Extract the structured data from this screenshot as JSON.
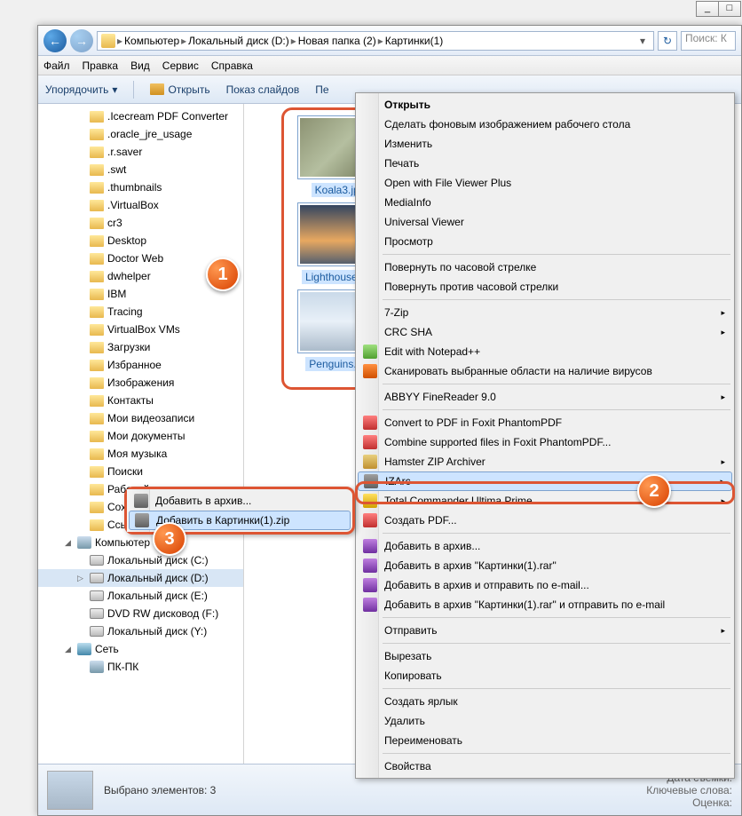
{
  "titlebar": {
    "min": "_",
    "max": "□"
  },
  "nav": {
    "back": "←",
    "fwd": "→",
    "refresh": "↻"
  },
  "breadcrumb": {
    "sep": "▸",
    "items": [
      "Компьютер",
      "Локальный диск (D:)",
      "Новая папка (2)",
      "Картинки(1)"
    ],
    "drop": "▾"
  },
  "search": {
    "placeholder": "Поиск: К"
  },
  "menu": {
    "items": [
      "Файл",
      "Правка",
      "Вид",
      "Сервис",
      "Справка"
    ]
  },
  "toolbar": {
    "organize": "Упорядочить",
    "organize_arr": "▾",
    "open": "Открыть",
    "slideshow": "Показ слайдов",
    "more": "Пе"
  },
  "tree": {
    "items": [
      {
        "l": 1,
        "t": "folder",
        "label": ".Icecream PDF Converter"
      },
      {
        "l": 1,
        "t": "folder",
        "label": ".oracle_jre_usage"
      },
      {
        "l": 1,
        "t": "folder",
        "label": ".r.saver"
      },
      {
        "l": 1,
        "t": "folder",
        "label": ".swt"
      },
      {
        "l": 1,
        "t": "folder",
        "label": ".thumbnails"
      },
      {
        "l": 1,
        "t": "folder",
        "label": ".VirtualBox"
      },
      {
        "l": 1,
        "t": "folder",
        "label": "cr3"
      },
      {
        "l": 1,
        "t": "folder",
        "label": "Desktop"
      },
      {
        "l": 1,
        "t": "folder",
        "label": "Doctor Web"
      },
      {
        "l": 1,
        "t": "folder",
        "label": "dwhelper"
      },
      {
        "l": 1,
        "t": "folder",
        "label": "IBM"
      },
      {
        "l": 1,
        "t": "folder",
        "label": "Tracing"
      },
      {
        "l": 1,
        "t": "folder",
        "label": "VirtualBox VMs"
      },
      {
        "l": 1,
        "t": "folder",
        "label": "Загрузки"
      },
      {
        "l": 1,
        "t": "folder",
        "label": "Избранное"
      },
      {
        "l": 1,
        "t": "folder",
        "label": "Изображения"
      },
      {
        "l": 1,
        "t": "folder",
        "label": "Контакты"
      },
      {
        "l": 1,
        "t": "folder",
        "label": "Мои видеозаписи"
      },
      {
        "l": 1,
        "t": "folder",
        "label": "Мои документы"
      },
      {
        "l": 1,
        "t": "folder",
        "label": "Моя музыка"
      },
      {
        "l": 1,
        "t": "folder",
        "label": "Поиски"
      },
      {
        "l": 1,
        "t": "folder",
        "label": "Рабочий стол"
      },
      {
        "l": 1,
        "t": "folder",
        "label": "Сохраненные игры"
      },
      {
        "l": 1,
        "t": "folder",
        "label": "Ссылки"
      },
      {
        "l": 0,
        "t": "comp",
        "label": "Компьютер",
        "exp": "◢"
      },
      {
        "l": 1,
        "t": "drive",
        "label": "Локальный диск (C:)"
      },
      {
        "l": 1,
        "t": "drive",
        "label": "Локальный диск (D:)",
        "sel": true,
        "exp": "▷"
      },
      {
        "l": 1,
        "t": "drive",
        "label": "Локальный диск (E:)"
      },
      {
        "l": 1,
        "t": "drive",
        "label": "DVD RW дисковод (F:)"
      },
      {
        "l": 1,
        "t": "drive",
        "label": "Локальный диск (Y:)"
      },
      {
        "l": 0,
        "t": "net",
        "label": "Сеть",
        "exp": "◢"
      },
      {
        "l": 1,
        "t": "comp",
        "label": "ПК-ПК"
      }
    ]
  },
  "files": {
    "items": [
      {
        "name": "Koala3.jpg",
        "cls": "koala"
      },
      {
        "name": "Lighthouse.jpg",
        "cls": "light"
      },
      {
        "name": "Penguins.jpg",
        "cls": "peng"
      }
    ]
  },
  "context_main": {
    "groups": [
      [
        {
          "label": "Открыть",
          "bold": true
        },
        {
          "label": "Сделать фоновым изображением рабочего стола"
        },
        {
          "label": "Изменить"
        },
        {
          "label": "Печать"
        },
        {
          "label": "Open with File Viewer Plus"
        },
        {
          "label": "MediaInfo"
        },
        {
          "label": "Universal Viewer"
        },
        {
          "label": "Просмотр"
        }
      ],
      [
        {
          "label": "Повернуть по часовой стрелке"
        },
        {
          "label": "Повернуть против часовой стрелки"
        }
      ],
      [
        {
          "label": "7-Zip",
          "sub": true
        },
        {
          "label": "CRC SHA",
          "sub": true
        },
        {
          "label": "Edit with Notepad++",
          "ico": "ico-np"
        },
        {
          "label": "Сканировать выбранные области на наличие вирусов",
          "ico": "ico-av"
        }
      ],
      [
        {
          "label": "ABBYY FineReader 9.0",
          "sub": true
        }
      ],
      [
        {
          "label": "Convert to PDF in Foxit PhantomPDF",
          "ico": "ico-pdf"
        },
        {
          "label": "Combine supported files in Foxit PhantomPDF...",
          "ico": "ico-pdf"
        },
        {
          "label": "Hamster ZIP Archiver",
          "sub": true,
          "ico": "ico-zip"
        },
        {
          "label": "IZArc",
          "sub": true,
          "hov": true,
          "ico": "ico-iz"
        },
        {
          "label": "Total Commander Ultima Prime",
          "sub": true,
          "ico": "ico-tc"
        },
        {
          "label": "Создать PDF...",
          "ico": "ico-pdf"
        }
      ],
      [
        {
          "label": "Добавить в архив...",
          "ico": "ico-rar"
        },
        {
          "label": "Добавить в архив \"Картинки(1).rar\"",
          "ico": "ico-rar"
        },
        {
          "label": "Добавить в архив и отправить по e-mail...",
          "ico": "ico-rar"
        },
        {
          "label": "Добавить в архив \"Картинки(1).rar\" и отправить по e-mail",
          "ico": "ico-rar"
        }
      ],
      [
        {
          "label": "Отправить",
          "sub": true
        }
      ],
      [
        {
          "label": "Вырезать"
        },
        {
          "label": "Копировать"
        }
      ],
      [
        {
          "label": "Создать ярлык"
        },
        {
          "label": "Удалить"
        },
        {
          "label": "Переименовать"
        }
      ],
      [
        {
          "label": "Свойства"
        }
      ]
    ]
  },
  "context_sub": {
    "items": [
      {
        "label": "Добавить в архив...",
        "ico": "ico-iz"
      },
      {
        "label": "Добавить в Картинки(1).zip",
        "ico": "ico-iz",
        "hov": true
      }
    ]
  },
  "status": {
    "selected": "Выбрано элементов: 3",
    "meta1_k": "Дата съемки:",
    "meta2_k": "Ключевые слова:",
    "meta3_k": "Оценка:"
  },
  "callouts": {
    "c1": "1",
    "c2": "2",
    "c3": "3"
  },
  "arrow": "▸"
}
